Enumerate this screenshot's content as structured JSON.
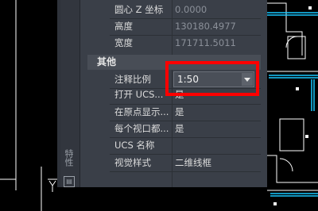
{
  "properties": {
    "rows_top": [
      {
        "label": "圆心 Z 坐标",
        "value": "0.0000"
      },
      {
        "label": "高度",
        "value": "130180.4977"
      },
      {
        "label": "宽度",
        "value": "171711.5011"
      }
    ],
    "section_title": "其他",
    "scale_dropdown": {
      "label": "注释比例",
      "value": "1:50"
    },
    "rows_bottom": [
      {
        "label": "打开 UCS...",
        "value": "是"
      },
      {
        "label": "在原点显示...",
        "value": "是"
      },
      {
        "label": "每个视口都...",
        "value": "是"
      },
      {
        "label": "UCS 名称",
        "value": ""
      },
      {
        "label": "视觉样式",
        "value": "二维线框"
      }
    ]
  },
  "palette_title": "特性",
  "colors": {
    "highlight": "#ff0000",
    "drawing_lines": "#19c8ff"
  }
}
